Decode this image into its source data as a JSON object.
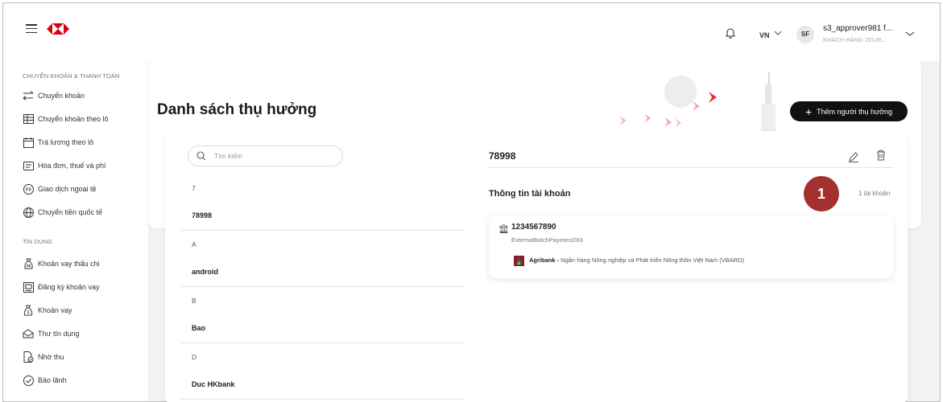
{
  "header": {
    "lang": "VN",
    "avatar_initials": "SF",
    "user_name": "s3_approver981 f...",
    "user_sub": "KHÁCH HÀNG 20145..."
  },
  "sidebar": {
    "sections": [
      {
        "title": "CHUYỂN KHOẢN & THANH TOÁN"
      },
      {
        "title": "TÍN DỤNG"
      }
    ],
    "items": [
      {
        "label": "Chuyển khoản",
        "icon": "transfer-arrows-icon"
      },
      {
        "label": "Chuyển khoản theo lô",
        "icon": "batch-table-icon"
      },
      {
        "label": "Trả lương theo lô",
        "icon": "calendar-icon"
      },
      {
        "label": "Hóa đơn, thuế và phí",
        "icon": "invoice-icon"
      },
      {
        "label": "Giao dịch ngoại tệ",
        "icon": "fx-icon"
      },
      {
        "label": "Chuyển tiền quốc tế",
        "icon": "globe-icon"
      },
      {
        "label": "Khoản vay thấu chi",
        "icon": "overdraft-icon"
      },
      {
        "label": "Đăng ký khoản vay",
        "icon": "loan-register-icon"
      },
      {
        "label": "Khoản vay",
        "icon": "money-bag-icon"
      },
      {
        "label": "Thư tín dụng",
        "icon": "envelope-icon"
      },
      {
        "label": "Nhờ thu",
        "icon": "collection-doc-icon"
      },
      {
        "label": "Bảo lãnh",
        "icon": "check-circle-icon"
      }
    ]
  },
  "page": {
    "title": "Danh sách thụ hưởng",
    "add_button": "Thêm người thụ hưởng"
  },
  "list": {
    "search_placeholder": "Tìm kiếm",
    "groups": [
      {
        "letter": "7",
        "name": "78998"
      },
      {
        "letter": "A",
        "name": "android"
      },
      {
        "letter": "B",
        "name": "Bao"
      },
      {
        "letter": "D",
        "name": "Duc HKbank"
      }
    ]
  },
  "detail": {
    "name": "78998",
    "info_title": "Thông tin tài khoản",
    "account_count": "1 tài khoản",
    "badge": "1",
    "account": {
      "number": "1234567890",
      "description": "ExternalBatchPayment283",
      "bank_short": "Agribank -",
      "bank_full": " Ngân hàng Nông nghiệp và Phát triển Nông thôn Việt Nam (VBARD)"
    }
  },
  "colors": {
    "brand_red": "#db0011",
    "badge": "#a3302f",
    "button": "#111111"
  }
}
